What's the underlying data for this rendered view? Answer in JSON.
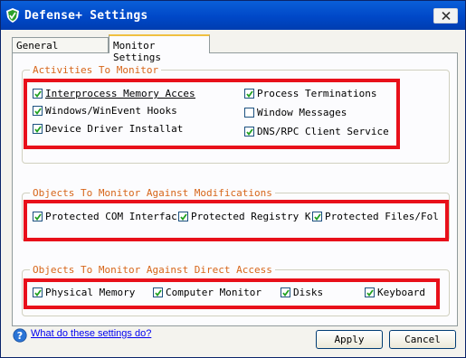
{
  "window": {
    "title": "Defense+ Settings"
  },
  "tabs": [
    {
      "label": "General Settings",
      "active": false
    },
    {
      "label": "Monitor Settings",
      "active": true
    }
  ],
  "groups": {
    "activities": {
      "label": "Activities To Monitor",
      "items": [
        {
          "label": "Interprocess Memory Accesses",
          "checked": true
        },
        {
          "label": "Windows/WinEvent Hooks",
          "checked": true
        },
        {
          "label": "Device Driver Installat",
          "checked": true
        },
        {
          "label": "Process Terminations",
          "checked": true
        },
        {
          "label": "Window Messages",
          "checked": false
        },
        {
          "label": "DNS/RPC Client Service",
          "checked": true
        }
      ]
    },
    "modifications": {
      "label": "Objects To Monitor Against Modifications",
      "items": [
        {
          "label": "Protected COM Interfaces",
          "checked": true
        },
        {
          "label": "Protected Registry Ke",
          "checked": true
        },
        {
          "label": "Protected Files/Fold",
          "checked": true
        }
      ]
    },
    "direct_access": {
      "label": "Objects To Monitor Against Direct Access",
      "items": [
        {
          "label": "Physical Memory",
          "checked": true
        },
        {
          "label": "Computer Monitor",
          "checked": true
        },
        {
          "label": "Disks",
          "checked": true
        },
        {
          "label": "Keyboard",
          "checked": true
        }
      ]
    }
  },
  "footer": {
    "help_link": "What do these settings do?",
    "apply_label": "Apply",
    "cancel_label": "Cancel"
  },
  "colors": {
    "group_label": "#d7661a",
    "highlight_box": "#e8101a",
    "titlebar": "#0048c8"
  }
}
